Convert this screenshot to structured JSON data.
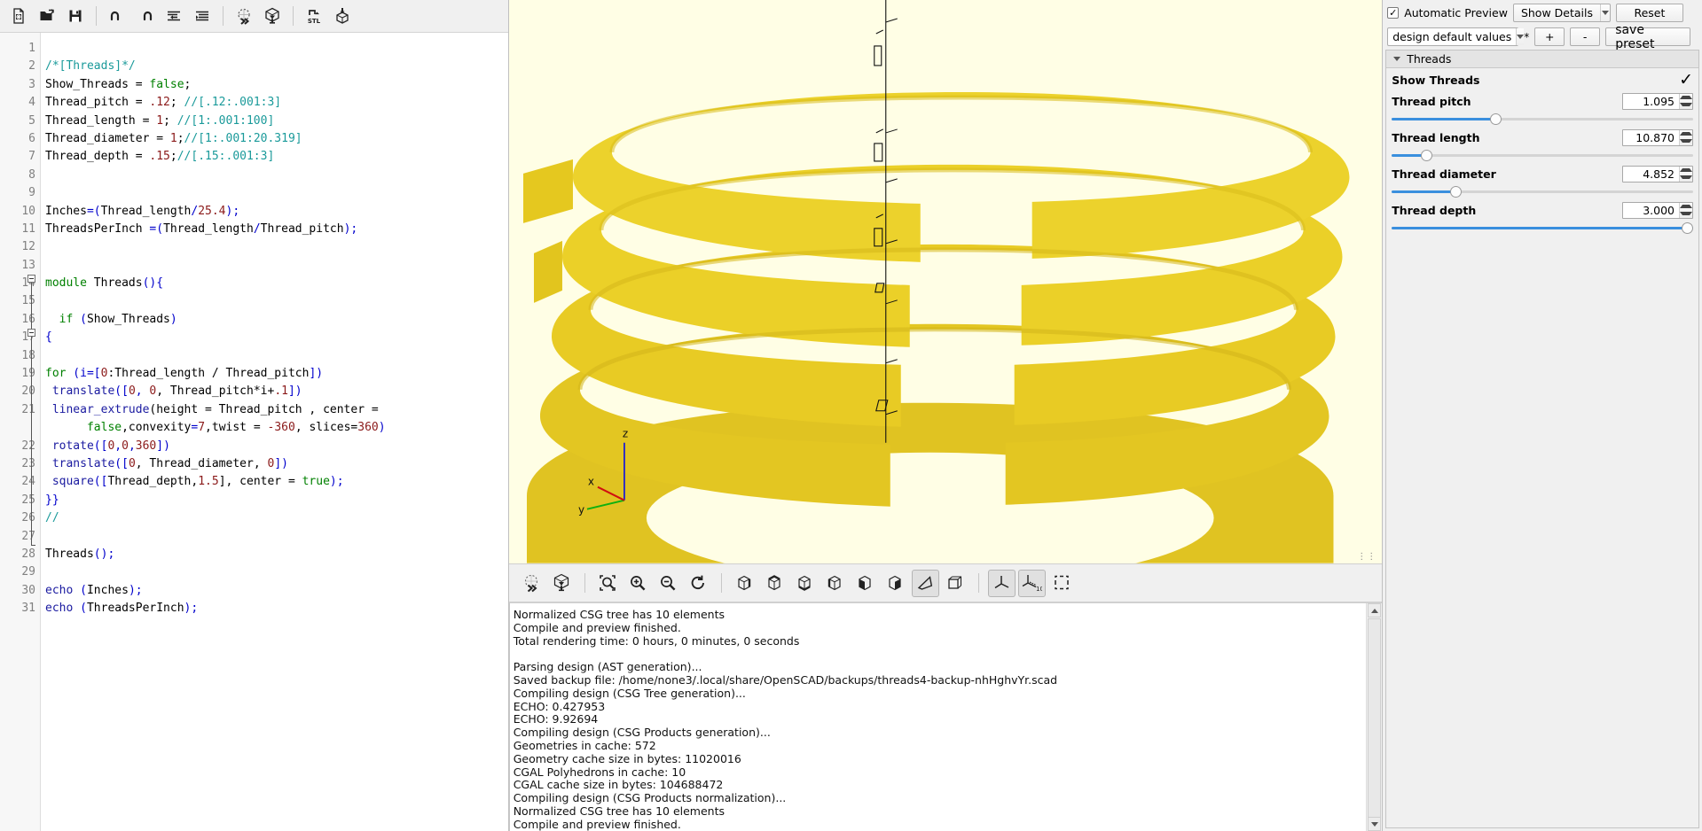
{
  "app": {
    "name": "OpenSCAD"
  },
  "toolbar": {
    "buttons": [
      {
        "name": "new-file-icon",
        "title": "New"
      },
      {
        "name": "open-file-icon",
        "title": "Open"
      },
      {
        "name": "save-file-icon",
        "title": "Save"
      },
      {
        "name": "undo-icon",
        "title": "Undo"
      },
      {
        "name": "redo-icon",
        "title": "Redo"
      },
      {
        "name": "unindent-icon",
        "title": "Unindent"
      },
      {
        "name": "indent-icon",
        "title": "Indent"
      },
      {
        "name": "preview-icon",
        "title": "Preview"
      },
      {
        "name": "render-icon",
        "title": "Render"
      },
      {
        "name": "export-stl-icon",
        "title": "Export as STL"
      },
      {
        "name": "export-amf-icon",
        "title": "Export as AMF"
      }
    ]
  },
  "editor": {
    "lines": [
      {
        "n": 1,
        "segments": []
      },
      {
        "n": 2,
        "segments": [
          {
            "t": "/*[Threads]*/",
            "c": "cm"
          }
        ]
      },
      {
        "n": 3,
        "segments": [
          {
            "t": "Show_Threads = ",
            "c": "pl"
          },
          {
            "t": "false",
            "c": "kw"
          },
          {
            "t": ";",
            "c": "pl"
          }
        ]
      },
      {
        "n": 4,
        "segments": [
          {
            "t": "Thread_pitch = ",
            "c": "pl"
          },
          {
            "t": ".12",
            "c": "num"
          },
          {
            "t": "; ",
            "c": "pl"
          },
          {
            "t": "//[.12:.001:3]",
            "c": "cm"
          }
        ]
      },
      {
        "n": 5,
        "segments": [
          {
            "t": "Thread_length = ",
            "c": "pl"
          },
          {
            "t": "1",
            "c": "num"
          },
          {
            "t": "; ",
            "c": "pl"
          },
          {
            "t": "//[1:.001:100]",
            "c": "cm"
          }
        ]
      },
      {
        "n": 6,
        "segments": [
          {
            "t": "Thread_diameter = ",
            "c": "pl"
          },
          {
            "t": "1",
            "c": "num"
          },
          {
            "t": ";",
            "c": "pl"
          },
          {
            "t": "//[1:.001:20.319]",
            "c": "cm"
          }
        ]
      },
      {
        "n": 7,
        "segments": [
          {
            "t": "Thread_depth = ",
            "c": "pl"
          },
          {
            "t": ".15",
            "c": "num"
          },
          {
            "t": ";",
            "c": "pl"
          },
          {
            "t": "//[.15:.001:3]",
            "c": "cm"
          }
        ]
      },
      {
        "n": 8,
        "segments": []
      },
      {
        "n": 9,
        "segments": []
      },
      {
        "n": 10,
        "segments": [
          {
            "t": "Inches",
            "c": "pl"
          },
          {
            "t": "=(",
            "c": "op"
          },
          {
            "t": "Thread_length",
            "c": "pl"
          },
          {
            "t": "/",
            "c": "op"
          },
          {
            "t": "25.4",
            "c": "num"
          },
          {
            "t": ");",
            "c": "op"
          }
        ]
      },
      {
        "n": 11,
        "segments": [
          {
            "t": "ThreadsPerInch ",
            "c": "pl"
          },
          {
            "t": "=(",
            "c": "op"
          },
          {
            "t": "Thread_length",
            "c": "pl"
          },
          {
            "t": "/",
            "c": "op"
          },
          {
            "t": "Thread_pitch",
            "c": "pl"
          },
          {
            "t": ");",
            "c": "op"
          }
        ]
      },
      {
        "n": 12,
        "segments": []
      },
      {
        "n": 13,
        "segments": []
      },
      {
        "n": 14,
        "segments": [
          {
            "t": "module",
            "c": "kw"
          },
          {
            "t": " Threads",
            "c": "pl"
          },
          {
            "t": "()",
            "c": "op"
          },
          {
            "t": "{",
            "c": "op"
          }
        ]
      },
      {
        "n": 15,
        "segments": []
      },
      {
        "n": 16,
        "segments": [
          {
            "t": "  ",
            "c": "pl"
          },
          {
            "t": "if",
            "c": "kw"
          },
          {
            "t": " ",
            "c": "pl"
          },
          {
            "t": "(",
            "c": "op"
          },
          {
            "t": "Show_Threads",
            "c": "pl"
          },
          {
            "t": ")",
            "c": "op"
          }
        ]
      },
      {
        "n": 17,
        "segments": [
          {
            "t": "{",
            "c": "op"
          }
        ]
      },
      {
        "n": 18,
        "segments": []
      },
      {
        "n": 19,
        "segments": [
          {
            "t": "for",
            "c": "kw"
          },
          {
            "t": " (i=[",
            "c": "op"
          },
          {
            "t": "0",
            "c": "num"
          },
          {
            "t": ":Thread_length / Thread_pitch",
            "c": "pl"
          },
          {
            "t": "])",
            "c": "op"
          }
        ]
      },
      {
        "n": 20,
        "segments": [
          {
            "t": " ",
            "c": "pl"
          },
          {
            "t": "translate",
            "c": "fn"
          },
          {
            "t": "([",
            "c": "op"
          },
          {
            "t": "0",
            "c": "num"
          },
          {
            "t": ", ",
            "c": "op"
          },
          {
            "t": "0",
            "c": "num"
          },
          {
            "t": ", Thread_pitch*i+",
            "c": "pl"
          },
          {
            "t": ".1",
            "c": "num"
          },
          {
            "t": "])",
            "c": "op"
          }
        ]
      },
      {
        "n": 21,
        "segments": [
          {
            "t": " ",
            "c": "pl"
          },
          {
            "t": "linear_extrude",
            "c": "fn"
          },
          {
            "t": "(height = Thread_pitch , center = ",
            "c": "pl"
          }
        ]
      },
      {
        "n": "",
        "segments": [
          {
            "t": "      ",
            "c": "pl"
          },
          {
            "t": "false",
            "c": "kw"
          },
          {
            "t": ",convexity",
            "c": "pl"
          },
          {
            "t": "=",
            "c": "op"
          },
          {
            "t": "7",
            "c": "num"
          },
          {
            "t": ",twist = ",
            "c": "pl"
          },
          {
            "t": "-360",
            "c": "num"
          },
          {
            "t": ", slices=",
            "c": "pl"
          },
          {
            "t": "360",
            "c": "num"
          },
          {
            "t": ")",
            "c": "op"
          }
        ]
      },
      {
        "n": 22,
        "segments": [
          {
            "t": " ",
            "c": "pl"
          },
          {
            "t": "rotate",
            "c": "fn"
          },
          {
            "t": "([",
            "c": "op"
          },
          {
            "t": "0",
            "c": "num"
          },
          {
            "t": ",",
            "c": "op"
          },
          {
            "t": "0",
            "c": "num"
          },
          {
            "t": ",",
            "c": "op"
          },
          {
            "t": "360",
            "c": "num"
          },
          {
            "t": "])",
            "c": "op"
          }
        ]
      },
      {
        "n": 23,
        "segments": [
          {
            "t": " ",
            "c": "pl"
          },
          {
            "t": "translate",
            "c": "fn"
          },
          {
            "t": "([",
            "c": "op"
          },
          {
            "t": "0",
            "c": "num"
          },
          {
            "t": ", Thread_diameter, ",
            "c": "pl"
          },
          {
            "t": "0",
            "c": "num"
          },
          {
            "t": "])",
            "c": "op"
          }
        ]
      },
      {
        "n": 24,
        "segments": [
          {
            "t": " ",
            "c": "pl"
          },
          {
            "t": "square",
            "c": "fn"
          },
          {
            "t": "([",
            "c": "op"
          },
          {
            "t": "Thread_depth,",
            "c": "pl"
          },
          {
            "t": "1.5",
            "c": "num"
          },
          {
            "t": "], center = ",
            "c": "pl"
          },
          {
            "t": "true",
            "c": "kw"
          },
          {
            "t": ");",
            "c": "op"
          }
        ]
      },
      {
        "n": 25,
        "segments": [
          {
            "t": "}}",
            "c": "op"
          }
        ]
      },
      {
        "n": 26,
        "segments": [
          {
            "t": "//",
            "c": "cm"
          }
        ]
      },
      {
        "n": 27,
        "segments": []
      },
      {
        "n": 28,
        "segments": [
          {
            "t": "Threads",
            "c": "pl"
          },
          {
            "t": "();",
            "c": "op"
          }
        ]
      },
      {
        "n": 29,
        "segments": []
      },
      {
        "n": 30,
        "segments": [
          {
            "t": "echo",
            "c": "fn"
          },
          {
            "t": " ",
            "c": "pl"
          },
          {
            "t": "(",
            "c": "op"
          },
          {
            "t": "Inches",
            "c": "pl"
          },
          {
            "t": ");",
            "c": "op"
          }
        ]
      },
      {
        "n": 31,
        "segments": [
          {
            "t": "echo",
            "c": "fn"
          },
          {
            "t": " ",
            "c": "pl"
          },
          {
            "t": "(",
            "c": "op"
          },
          {
            "t": "ThreadsPerInch",
            "c": "pl"
          },
          {
            "t": ");",
            "c": "op"
          }
        ]
      }
    ]
  },
  "viewport": {
    "background_color": "#fffee5",
    "model_color": "#e8cd26",
    "model_shadow_color": "#d4b91f",
    "axis": {
      "x_label": "x",
      "y_label": "y",
      "z_label": "z",
      "x_color": "#d01010",
      "y_color": "#10b010",
      "z_color": "#2020d0"
    },
    "resize_grip": "⋮⋮"
  },
  "viewport_toolbar": {
    "buttons": [
      {
        "name": "preview-icon",
        "title": "Preview",
        "active": false
      },
      {
        "name": "render-icon",
        "title": "Render",
        "active": false
      },
      {
        "name": "zoom-all-icon",
        "title": "View All",
        "active": false
      },
      {
        "name": "zoom-in-icon",
        "title": "Zoom In",
        "active": false
      },
      {
        "name": "zoom-out-icon",
        "title": "Zoom Out",
        "active": false
      },
      {
        "name": "reset-view-icon",
        "title": "Reset View",
        "active": false
      },
      {
        "name": "view-right-icon",
        "title": "Right",
        "active": false
      },
      {
        "name": "view-top-icon",
        "title": "Top",
        "active": false
      },
      {
        "name": "view-bottom-icon",
        "title": "Bottom",
        "active": false
      },
      {
        "name": "view-left-icon",
        "title": "Left",
        "active": false
      },
      {
        "name": "view-front-icon",
        "title": "Front",
        "active": false
      },
      {
        "name": "view-back-icon",
        "title": "Back",
        "active": false
      },
      {
        "name": "perspective-icon",
        "title": "Perspective",
        "active": true
      },
      {
        "name": "orthogonal-icon",
        "title": "Orthogonal",
        "active": false
      },
      {
        "name": "show-axes-icon",
        "title": "Show Axes",
        "active": true
      },
      {
        "name": "show-scale-icon",
        "title": "Show Scale Markers",
        "active": true
      },
      {
        "name": "show-edges-icon",
        "title": "Show Edges",
        "active": false
      }
    ]
  },
  "console": {
    "lines": [
      "Normalized CSG tree has 10 elements",
      "Compile and preview finished.",
      "Total rendering time: 0 hours, 0 minutes, 0 seconds",
      "",
      "Parsing design (AST generation)...",
      "Saved backup file: /home/none3/.local/share/OpenSCAD/backups/threads4-backup-nhHghvYr.scad",
      "Compiling design (CSG Tree generation)...",
      "ECHO: 0.427953",
      "ECHO: 9.92694",
      "Compiling design (CSG Products generation)...",
      "Geometries in cache: 572",
      "Geometry cache size in bytes: 11020016",
      "CGAL Polyhedrons in cache: 10",
      "CGAL cache size in bytes: 104688472",
      "Compiling design (CSG Products normalization)...",
      "Normalized CSG tree has 10 elements",
      "Compile and preview finished."
    ]
  },
  "parameters": {
    "automatic_preview": {
      "label": "Automatic Preview",
      "checked": true
    },
    "detail_level": {
      "value": "Show Details"
    },
    "reset_button": "Reset",
    "preset": {
      "value": "design default values"
    },
    "asterisk": "*",
    "add_button": "+",
    "remove_button": "-",
    "save_preset_button": "save preset",
    "group": {
      "title": "Threads",
      "expanded": true,
      "items": [
        {
          "kind": "checkbox",
          "label": "Show Threads",
          "checked": true,
          "check_glyph": "✓"
        },
        {
          "kind": "slider",
          "label": "Thread pitch",
          "value": "1.095",
          "fill_pct": 34
        },
        {
          "kind": "slider",
          "label": "Thread length",
          "value": "10.870",
          "fill_pct": 10
        },
        {
          "kind": "slider",
          "label": "Thread diameter",
          "value": "4.852",
          "fill_pct": 20
        },
        {
          "kind": "slider",
          "label": "Thread depth",
          "value": "3.000",
          "fill_pct": 100
        }
      ]
    },
    "accent_color": "#3a8fde"
  }
}
